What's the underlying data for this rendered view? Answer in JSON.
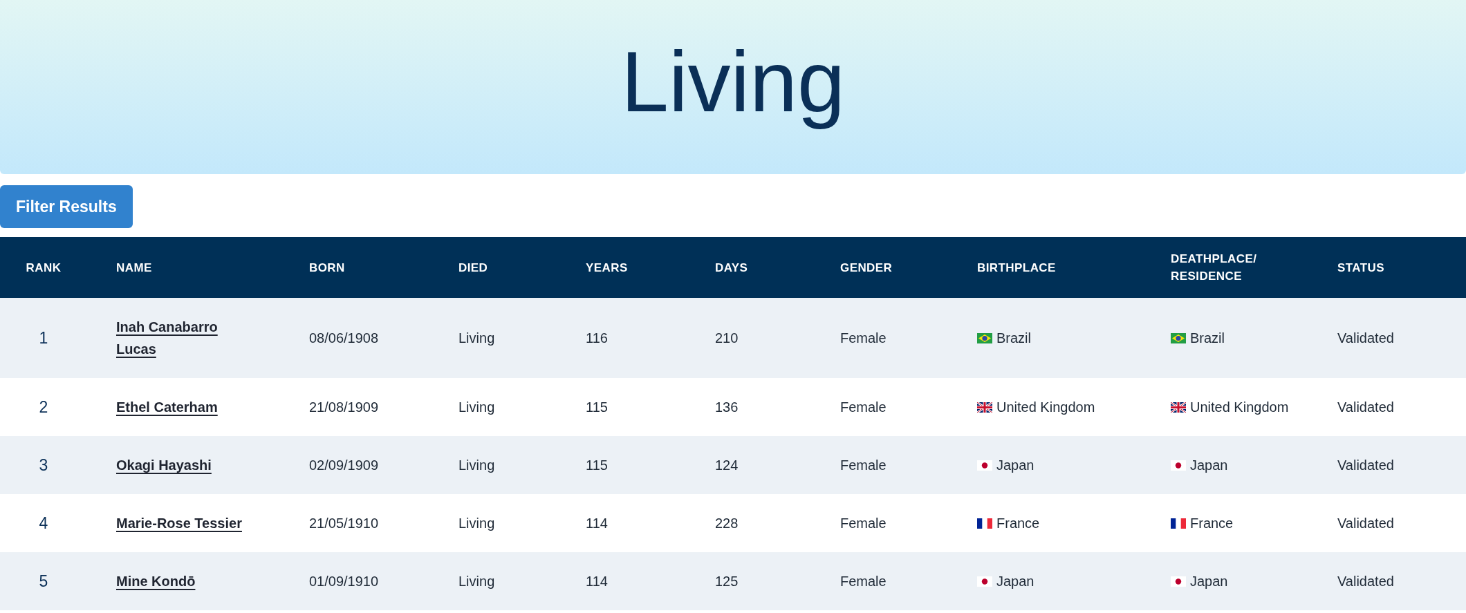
{
  "title": "Living",
  "filter_button": "Filter Results",
  "table": {
    "columns": [
      "RANK",
      "NAME",
      "BORN",
      "DIED",
      "YEARS",
      "DAYS",
      "GENDER",
      "BIRTHPLACE",
      "DEATHPLACE/ RESIDENCE",
      "STATUS"
    ],
    "rows": [
      {
        "rank": "1",
        "name": "Inah Canabarro Lucas",
        "born": "08/06/1908",
        "died": "Living",
        "years": "116",
        "days": "210",
        "gender": "Female",
        "birthplace": {
          "kind": "br",
          "country": "Brazil"
        },
        "deathplace": {
          "kind": "br",
          "country": "Brazil"
        },
        "status": "Validated"
      },
      {
        "rank": "2",
        "name": "Ethel Caterham",
        "born": "21/08/1909",
        "died": "Living",
        "years": "115",
        "days": "136",
        "gender": "Female",
        "birthplace": {
          "kind": "gb",
          "country": "United Kingdom"
        },
        "deathplace": {
          "kind": "gb",
          "country": "United Kingdom"
        },
        "status": "Validated"
      },
      {
        "rank": "3",
        "name": "Okagi Hayashi",
        "born": "02/09/1909",
        "died": "Living",
        "years": "115",
        "days": "124",
        "gender": "Female",
        "birthplace": {
          "kind": "jp",
          "country": "Japan"
        },
        "deathplace": {
          "kind": "jp",
          "country": "Japan"
        },
        "status": "Validated"
      },
      {
        "rank": "4",
        "name": "Marie-Rose Tessier",
        "born": "21/05/1910",
        "died": "Living",
        "years": "114",
        "days": "228",
        "gender": "Female",
        "birthplace": {
          "kind": "fr",
          "country": "France"
        },
        "deathplace": {
          "kind": "fr",
          "country": "France"
        },
        "status": "Validated"
      },
      {
        "rank": "5",
        "name": "Mine Kondō",
        "born": "01/09/1910",
        "died": "Living",
        "years": "114",
        "days": "125",
        "gender": "Female",
        "birthplace": {
          "kind": "jp",
          "country": "Japan"
        },
        "deathplace": {
          "kind": "jp",
          "country": "Japan"
        },
        "status": "Validated"
      }
    ]
  }
}
